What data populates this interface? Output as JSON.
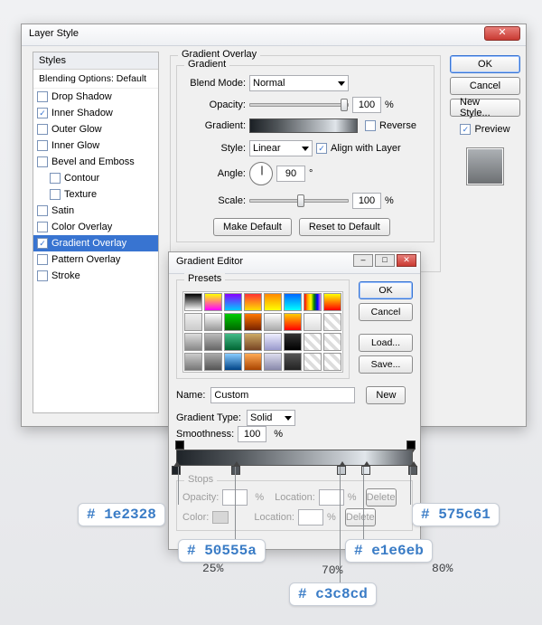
{
  "dialog": {
    "title": "Layer Style",
    "close_symbol": "✕"
  },
  "styles_panel": {
    "header": "Styles",
    "subheader": "Blending Options: Default",
    "items": [
      {
        "label": "Drop Shadow",
        "checked": false
      },
      {
        "label": "Inner Shadow",
        "checked": true
      },
      {
        "label": "Outer Glow",
        "checked": false
      },
      {
        "label": "Inner Glow",
        "checked": false
      },
      {
        "label": "Bevel and Emboss",
        "checked": false
      },
      {
        "label": "Contour",
        "checked": false,
        "indent": true
      },
      {
        "label": "Texture",
        "checked": false,
        "indent": true
      },
      {
        "label": "Satin",
        "checked": false
      },
      {
        "label": "Color Overlay",
        "checked": false
      },
      {
        "label": "Gradient Overlay",
        "checked": true,
        "selected": true
      },
      {
        "label": "Pattern Overlay",
        "checked": false
      },
      {
        "label": "Stroke",
        "checked": false
      }
    ]
  },
  "main_group": {
    "title": "Gradient Overlay",
    "inner_title": "Gradient",
    "blend_mode_label": "Blend Mode:",
    "blend_mode_value": "Normal",
    "opacity_label": "Opacity:",
    "opacity_value": "100",
    "percent": "%",
    "gradient_label": "Gradient:",
    "reverse_label": "Reverse",
    "style_label": "Style:",
    "style_value": "Linear",
    "align_label": "Align with Layer",
    "angle_label": "Angle:",
    "angle_value": "90",
    "angle_degree": "°",
    "scale_label": "Scale:",
    "scale_value": "100",
    "make_default": "Make Default",
    "reset_default": "Reset to Default"
  },
  "right": {
    "ok": "OK",
    "cancel": "Cancel",
    "new_style": "New Style...",
    "preview": "Preview"
  },
  "editor": {
    "title": "Gradient Editor",
    "presets_label": "Presets",
    "ok": "OK",
    "cancel": "Cancel",
    "load": "Load...",
    "save": "Save...",
    "name_label": "Name:",
    "name_value": "Custom",
    "new": "New",
    "type_label": "Gradient Type:",
    "type_value": "Solid",
    "smooth_label": "Smoothness:",
    "smooth_value": "100",
    "stops_label": "Stops",
    "op_opacity": "Opacity:",
    "op_loc": "Location:",
    "op_del": "Delete",
    "col_color": "Color:",
    "col_loc": "Location:",
    "col_del": "Delete",
    "swatches": [
      "linear-gradient(#000,#fff)",
      "linear-gradient(#ff0,#f0f)",
      "linear-gradient(#80f,#0cf)",
      "linear-gradient(#f33,#fd0)",
      "linear-gradient(#f80,#ff0)",
      "linear-gradient(#06f,#0ff)",
      "linear-gradient(90deg,red,orange,yellow,green,blue,violet)",
      "linear-gradient(#ff0,#f00)",
      "linear-gradient(#eee,#ccc)",
      "linear-gradient(#fff,#999)",
      "linear-gradient(#0c0,#060)",
      "linear-gradient(#f70,#720)",
      "linear-gradient(#fff,#aaa)",
      "linear-gradient(#fc0,#f00)",
      "linear-gradient(#fff,#ddd)",
      "repeating-linear-gradient(45deg,#ddd 0 4px,#fff 4px 8px)",
      "linear-gradient(#ddd,#888)",
      "linear-gradient(#bbb,#666)",
      "linear-gradient(#4b8,#063)",
      "linear-gradient(#ca6,#742)",
      "linear-gradient(#eef,#99c)",
      "linear-gradient(#333,#000)",
      "repeating-linear-gradient(45deg,#ddd 0 4px,#fff 4px 8px)",
      "repeating-linear-gradient(45deg,#ddd 0 4px,#fff 4px 8px)",
      "linear-gradient(#ccc,#777)",
      "linear-gradient(#aaa,#555)",
      "linear-gradient(#8cf,#048)",
      "linear-gradient(#fa5,#a40)",
      "linear-gradient(#dde,#88a)",
      "linear-gradient(#555,#222)",
      "repeating-linear-gradient(45deg,#ddd 0 4px,#fff 4px 8px)",
      "repeating-linear-gradient(45deg,#ddd 0 4px,#fff 4px 8px)"
    ]
  },
  "stops": [
    {
      "pos": 0,
      "color": "#1e2328"
    },
    {
      "pos": 25,
      "color": "#50555a"
    },
    {
      "pos": 70,
      "color": "#c3c8cd"
    },
    {
      "pos": 80,
      "color": "#e1e6eb"
    },
    {
      "pos": 100,
      "color": "#575c61"
    }
  ],
  "annotations": {
    "a0": "# 1e2328",
    "a1": "# 50555a",
    "a1pct": "25%",
    "a2": "# c3c8cd",
    "a2pct": "70%",
    "a3": "# e1e6eb",
    "a3pct": "80%",
    "a4": "# 575c61"
  }
}
